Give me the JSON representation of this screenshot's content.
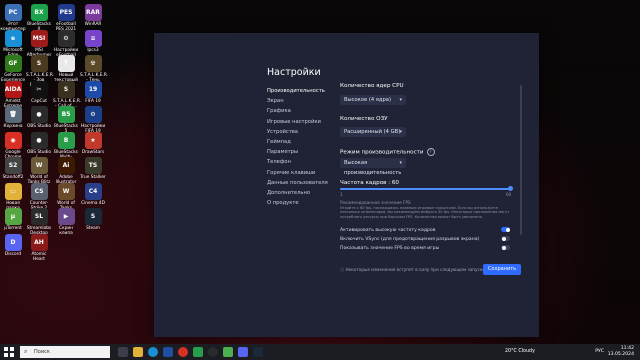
{
  "desktop": {
    "icons": [
      {
        "label": "Этот компьютер",
        "color": "#3b6fb6",
        "glyph": "PC"
      },
      {
        "label": "BlueStacks X",
        "color": "#1aa34a",
        "glyph": "BX"
      },
      {
        "label": "eFootball PES 2021",
        "color": "#203a8c",
        "glyph": "PES"
      },
      {
        "label": "WinRAR",
        "color": "#7a3b9c",
        "glyph": "RAR"
      },
      {
        "label": "Microsoft Edge",
        "color": "#1b8fd6",
        "glyph": "e"
      },
      {
        "label": "MSI Afterburner",
        "color": "#9e1b1b",
        "glyph": "MSI"
      },
      {
        "label": "Настройки eFootball P...",
        "color": "#2d2d2d",
        "glyph": "⚙"
      },
      {
        "label": "lpcs3",
        "color": "#7645c9",
        "glyph": "≡"
      },
      {
        "label": "GeForce Experience",
        "color": "#2f7a1a",
        "glyph": "GF"
      },
      {
        "label": "S.T.A.L.K.E.R. - Зов Припя...",
        "color": "#4a3a20",
        "glyph": "S"
      },
      {
        "label": "Новый текстовый ...",
        "color": "#e8e8e8",
        "glyph": "T"
      },
      {
        "label": "S.T.A.L.K.E.R. - Тень Черн...",
        "color": "#5a4a2a",
        "glyph": "☢"
      },
      {
        "label": "Amidst Extreme",
        "color": "#b21818",
        "glyph": "AIDA"
      },
      {
        "label": "CapCut",
        "color": "#111",
        "glyph": "✂"
      },
      {
        "label": "S.T.A.L.K.E.R. - Call of ...",
        "color": "#3a3020",
        "glyph": "S"
      },
      {
        "label": "FIFA 19",
        "color": "#1e4aa8",
        "glyph": "19"
      },
      {
        "label": "Корзина",
        "color": "#5a6a7a",
        "glyph": "🗑"
      },
      {
        "label": "OBS Studio",
        "color": "#2b2b2b",
        "glyph": "●"
      },
      {
        "label": "BlueStacks 5",
        "color": "#2a9d4a",
        "glyph": "B5"
      },
      {
        "label": "Настройки FIFA 19",
        "color": "#1b3f88",
        "glyph": "⚙"
      },
      {
        "label": "Google Chrome",
        "color": "#d93025",
        "glyph": "◉"
      },
      {
        "label": "OBS Studio (...",
        "color": "#2b2b2b",
        "glyph": "●"
      },
      {
        "label": "BlueStacks Multi-Insta...",
        "color": "#2a9d4a",
        "glyph": "B"
      },
      {
        "label": "DrawStars",
        "color": "#c0392b",
        "glyph": "★"
      },
      {
        "label": "Standoff2",
        "color": "#444",
        "glyph": "S2"
      },
      {
        "label": "World of Tanks Blitz",
        "color": "#6a5a3a",
        "glyph": "W"
      },
      {
        "label": "Adobe Illustrator 2...",
        "color": "#3b1a00",
        "glyph": "Ai"
      },
      {
        "label": "True Stalker",
        "color": "#3a3a2a",
        "glyph": "TS"
      },
      {
        "label": "Новая папка",
        "color": "#e0b23a",
        "glyph": "▭"
      },
      {
        "label": "Counter-Strike 2",
        "color": "#5a6070",
        "glyph": "CS"
      },
      {
        "label": "World of Tanks",
        "color": "#6a4a2a",
        "glyph": "W"
      },
      {
        "label": "Cinema 4D",
        "color": "#2a3f8a",
        "glyph": "C4"
      },
      {
        "label": "µTorrent",
        "color": "#56a644",
        "glyph": "µ"
      },
      {
        "label": "Streamlabs Desktop",
        "color": "#2b2b2b",
        "glyph": "SL"
      },
      {
        "label": "Скрин клипа",
        "color": "#6a4a8a",
        "glyph": "▶"
      },
      {
        "label": "Steam",
        "color": "#1b2838",
        "glyph": "S"
      },
      {
        "label": "Discord",
        "color": "#5865f2",
        "glyph": "D"
      },
      {
        "label": "Atomic Heart",
        "color": "#8a1a1a",
        "glyph": "AH"
      }
    ]
  },
  "window": {
    "title": "Настройки",
    "nav": [
      "Производительность",
      "Экран",
      "Графика",
      "Игровые настройки",
      "Устройства",
      "Геймпад",
      "Параметры",
      "Телефон",
      "Горячие клавиши",
      "Данные пользователя",
      "Дополнительно",
      "О продукте"
    ],
    "active_nav": 0,
    "cpu": {
      "label": "Количество ядер CPU",
      "value": "Высокое (4 ядра)"
    },
    "ram": {
      "label": "Количество ОЗУ",
      "value": "Расширенный (4 GB)"
    },
    "perf": {
      "label": "Режим производительности",
      "value": "Высокая производительность"
    },
    "fps": {
      "label": "Частота кадров : 60",
      "min": "1",
      "max": "60",
      "value": 60,
      "range": [
        1,
        60
      ],
      "note_title": "Рекомендованное значение FPS",
      "note": "Играйте с 60 fps, наслаждаясь плавным игровым процессом. Если вы используете несколько экземпляров, мы рекомендуем выбрать 30 fps. Некоторые приложения могут потреблять ресурсы при Высоком FPS. Количество может быть увеличено."
    },
    "toggles": [
      {
        "label": "Активировать высокую частоту кадров",
        "on": true
      },
      {
        "label": "Включить VSync (для предотвращения разрывов экрана)",
        "on": false
      },
      {
        "label": "Показывать значение FPS во время игры",
        "on": false
      }
    ],
    "footer_note": "Некоторые изменения вступят в силу при следующем запуске",
    "save_label": "Сохранить",
    "accent": "#2f6bff"
  },
  "taskbar": {
    "search_placeholder": "Поиск",
    "weather": "20°C Cloudy",
    "lang": "РУС",
    "time": "11:42",
    "date": "13.05.2024"
  }
}
